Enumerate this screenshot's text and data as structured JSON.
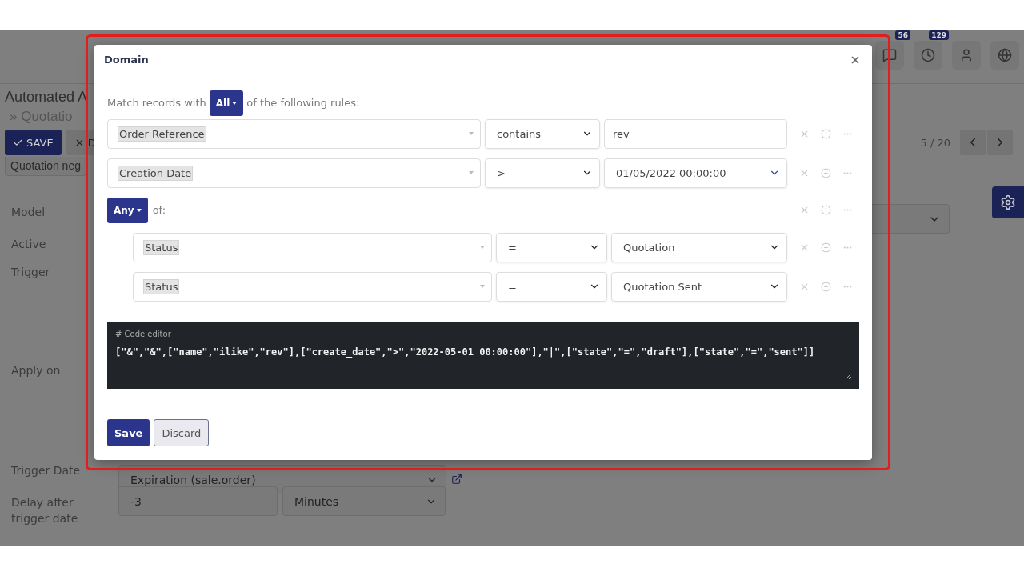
{
  "top_bar": {
    "notifications": [
      {
        "kind": "chat",
        "count": "56"
      },
      {
        "kind": "clock",
        "count": "129"
      },
      {
        "kind": "avatar"
      },
      {
        "kind": "globe"
      }
    ]
  },
  "page": {
    "title": "Automated A",
    "breadcrumb": "» Quotatio",
    "buttons": [
      {
        "label": "SAVE",
        "kind": "primary"
      },
      {
        "label": "D",
        "kind": "secondary"
      }
    ],
    "name_field": "Quotation neg",
    "pager": "5 / 20"
  },
  "fields": [
    {
      "label": "Model",
      "kind": "select"
    },
    {
      "label": "Active",
      "kind": "checkbox"
    },
    {
      "label": "Trigger",
      "kind": "radio"
    },
    {
      "label": "Apply on",
      "kind": "domain"
    },
    {
      "label": "Trigger Date",
      "kind": "select_link",
      "value": "Expiration (sale.order)"
    },
    {
      "label": "Delay after trigger date",
      "kind": "delay",
      "value": "-3",
      "unit": "Minutes"
    }
  ],
  "dialog": {
    "title": "Domain",
    "match_prefix": "Match records with",
    "match_mode": "All",
    "match_suffix": "of the following rules:",
    "rules": [
      {
        "kind": "condition",
        "field": "Order Reference",
        "operator": "contains",
        "value": {
          "kind": "text",
          "text": "rev"
        }
      },
      {
        "kind": "condition",
        "field": "Creation Date",
        "operator": ">",
        "value": {
          "kind": "datetime",
          "text": "01/05/2022 00:00:00"
        }
      },
      {
        "kind": "group",
        "mode": "Any",
        "suffix": "of:",
        "children": [
          {
            "field": "Status",
            "operator": "=",
            "value": {
              "kind": "select",
              "text": "Quotation"
            }
          },
          {
            "field": "Status",
            "operator": "=",
            "value": {
              "kind": "select",
              "text": "Quotation Sent"
            }
          }
        ]
      }
    ],
    "code_editor": {
      "label": "# Code editor",
      "code": "[\"&\",\"&\",[\"name\",\"ilike\",\"rev\"],[\"create_date\",\">\",\"2022-05-01 00:00:00\"],\"|\",[\"state\",\"=\",\"draft\"],[\"state\",\"=\",\"sent\"]]"
    },
    "buttons": [
      {
        "label": "Save",
        "kind": "primary"
      },
      {
        "label": "Discard",
        "kind": "secondary"
      }
    ]
  }
}
